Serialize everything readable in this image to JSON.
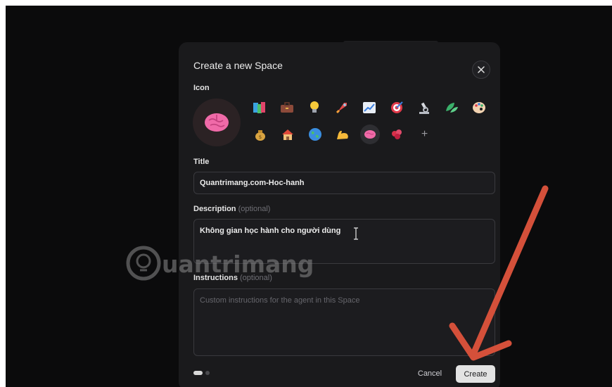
{
  "modal": {
    "title": "Create a new Space",
    "close_icon": "close-icon"
  },
  "icon_section": {
    "label": "Icon",
    "selected": "brain-emoji",
    "row1": [
      "books-emoji",
      "briefcase-emoji",
      "light-bulb-emoji",
      "rocket-emoji",
      "chart-emoji",
      "target-emoji",
      "microscope-emoji",
      "leaves-emoji",
      "palette-emoji"
    ],
    "row2": [
      "money-bag-emoji",
      "house-emoji",
      "globe-emoji",
      "flexed-bicep-emoji",
      "brain-emoji",
      "petals-emoji",
      "plus-icon"
    ]
  },
  "title_field": {
    "label": "Title",
    "value": "Quantrimang.com-Hoc-hanh"
  },
  "description_field": {
    "label": "Description",
    "optional": "(optional)",
    "value": "Không gian học hành cho người dùng"
  },
  "instructions_field": {
    "label": "Instructions",
    "optional": "(optional)",
    "placeholder": "Custom instructions for the agent in this Space"
  },
  "footer": {
    "cancel_label": "Cancel",
    "create_label": "Create"
  },
  "overlays": {
    "watermark_text": "uantrimang",
    "arrow_color": "#d4503a"
  },
  "colors": {
    "modal_bg": "#1a1a1c",
    "screen_bg": "#0b0b0c",
    "create_button_bg": "#e3e3e3"
  }
}
